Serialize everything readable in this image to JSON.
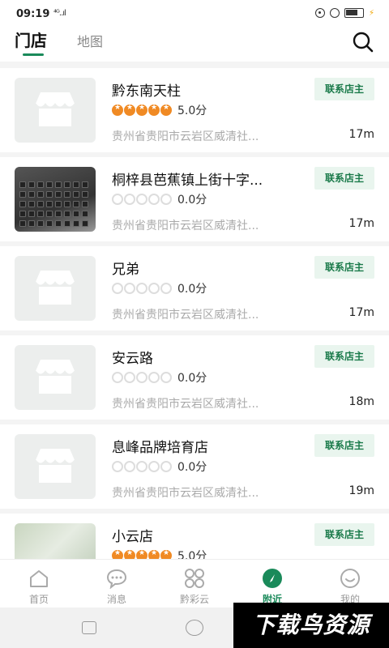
{
  "status_bar": {
    "time": "09:19",
    "signal": "⁴ᴳ..ıl"
  },
  "tabs": {
    "stores": "门店",
    "map": "地图"
  },
  "contact_label": "联系店主",
  "stores": [
    {
      "name": "黔东南天柱",
      "rating": 5,
      "score": "5.0分",
      "address": "贵州省贵阳市云岩区威清社...",
      "distance": "17m",
      "thumb": "placeholder"
    },
    {
      "name": "桐梓县芭蕉镇上街十字...",
      "rating": 0,
      "score": "0.0分",
      "address": "贵州省贵阳市云岩区威清社...",
      "distance": "17m",
      "thumb": "keyboard"
    },
    {
      "name": "兄弟",
      "rating": 0,
      "score": "0.0分",
      "address": "贵州省贵阳市云岩区威清社...",
      "distance": "17m",
      "thumb": "placeholder"
    },
    {
      "name": "安云路",
      "rating": 0,
      "score": "0.0分",
      "address": "贵州省贵阳市云岩区威清社...",
      "distance": "18m",
      "thumb": "placeholder"
    },
    {
      "name": "息峰品牌培育店",
      "rating": 0,
      "score": "0.0分",
      "address": "贵州省贵阳市云岩区威清社...",
      "distance": "19m",
      "thumb": "placeholder"
    },
    {
      "name": "小云店",
      "rating": 5,
      "score": "5.0分",
      "address": "",
      "distance": "",
      "thumb": "photo"
    }
  ],
  "bottom_nav": [
    {
      "label": "首页",
      "icon": "home-icon"
    },
    {
      "label": "消息",
      "icon": "message-icon"
    },
    {
      "label": "黔彩云",
      "icon": "grid-icon"
    },
    {
      "label": "附近",
      "icon": "compass-icon"
    },
    {
      "label": "我的",
      "icon": "smile-icon"
    }
  ],
  "active_nav": 3,
  "watermark": "下载鸟资源",
  "colors": {
    "accent": "#1a8a5a",
    "star": "#f08a24",
    "contact_bg": "#e9f5ee"
  }
}
